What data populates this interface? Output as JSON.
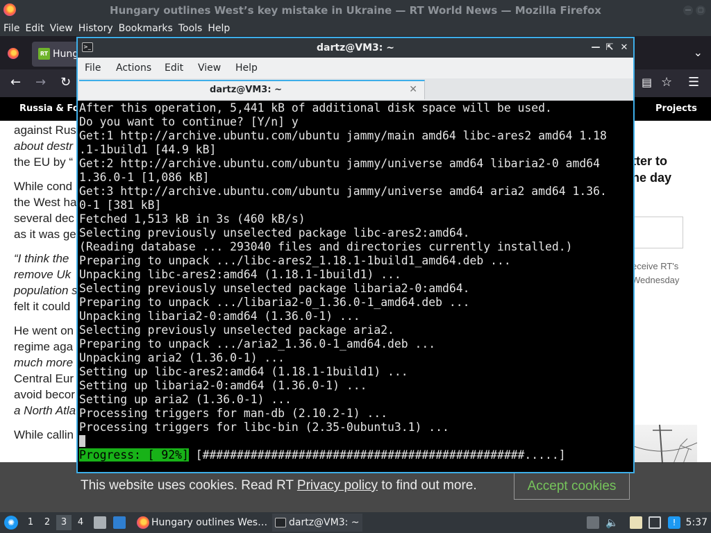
{
  "firefox": {
    "window_title": "Hungary outlines West’s key mistake in Ukraine — RT World News — Mozilla Firefox",
    "menu": [
      "File",
      "Edit",
      "View",
      "History",
      "Bookmarks",
      "Tools",
      "Help"
    ],
    "tab_title": "Hung",
    "tab_favicon": "RT",
    "rt_nav": {
      "left": "Russia & Fori",
      "right": "Projects"
    }
  },
  "article": {
    "paragraphs": [
      [
        {
          "t": "against Rus",
          "i": false
        },
        {
          "t": "about destr",
          "i": true
        },
        {
          "t": "the EU by “",
          "i": false
        }
      ],
      [
        {
          "t": "While cond",
          "i": false
        },
        {
          "t": "the West ha",
          "i": false
        },
        {
          "t": "several dec",
          "i": false
        },
        {
          "t": "as it was ge",
          "i": false
        }
      ],
      [
        {
          "t": "“I think the",
          "i": true
        },
        {
          "t": "remove Uk",
          "i": true
        },
        {
          "t": "population s",
          "i": true
        },
        {
          "t": "felt it could",
          "i": false
        }
      ],
      [
        {
          "t": "He went on",
          "i": false
        },
        {
          "t": "regime aga",
          "i": false
        },
        {
          "t": "much more",
          "i": true
        },
        {
          "t": "Central Eur",
          "i": false
        },
        {
          "t": "avoid becor",
          "i": false
        },
        {
          "t": "a North Atla",
          "i": true
        }
      ],
      [
        {
          "t": "While callin",
          "i": false
        }
      ]
    ]
  },
  "sidebar": {
    "promo": [
      "tter to",
      "ne day"
    ],
    "note": [
      "eceive RT's",
      " Wednesday"
    ]
  },
  "cookie": {
    "text_before": "This website uses cookies. Read RT ",
    "link": "Privacy policy",
    "text_after": " to find out more.",
    "button": "Accept cookies"
  },
  "terminal": {
    "window_title": "dartz@VM3: ~",
    "menu": [
      "File",
      "Actions",
      "Edit",
      "View",
      "Help"
    ],
    "tab_title": "dartz@VM3: ~",
    "lines": [
      "After this operation, 5,441 kB of additional disk space will be used.",
      "Do you want to continue? [Y/n] y",
      "Get:1 http://archive.ubuntu.com/ubuntu jammy/main amd64 libc-ares2 amd64 1.18",
      ".1-1build1 [44.9 kB]",
      "Get:2 http://archive.ubuntu.com/ubuntu jammy/universe amd64 libaria2-0 amd64",
      "1.36.0-1 [1,086 kB]",
      "Get:3 http://archive.ubuntu.com/ubuntu jammy/universe amd64 aria2 amd64 1.36.",
      "0-1 [381 kB]",
      "Fetched 1,513 kB in 3s (460 kB/s)",
      "Selecting previously unselected package libc-ares2:amd64.",
      "(Reading database ... 293040 files and directories currently installed.)",
      "Preparing to unpack .../libc-ares2_1.18.1-1build1_amd64.deb ...",
      "Unpacking libc-ares2:amd64 (1.18.1-1build1) ...",
      "Selecting previously unselected package libaria2-0:amd64.",
      "Preparing to unpack .../libaria2-0_1.36.0-1_amd64.deb ...",
      "Unpacking libaria2-0:amd64 (1.36.0-1) ...",
      "Selecting previously unselected package aria2.",
      "Preparing to unpack .../aria2_1.36.0-1_amd64.deb ...",
      "Unpacking aria2 (1.36.0-1) ...",
      "Setting up libc-ares2:amd64 (1.18.1-1build1) ...",
      "Setting up libaria2-0:amd64 (1.36.0-1) ...",
      "Setting up aria2 (1.36.0-1) ...",
      "Processing triggers for man-db (2.10.2-1) ...",
      "Processing triggers for libc-bin (2.35-0ubuntu3.1) ..."
    ],
    "progress_label": "Progress: [ 92%]",
    "progress_bar": " [###############################################.....]",
    "progress_value": 0.92
  },
  "taskbar": {
    "workspaces": [
      "1",
      "2",
      "3",
      "4"
    ],
    "active_workspace": "3",
    "tasks": [
      "Hungary outlines Wes…",
      "dartz@VM3: ~"
    ],
    "clock": "5:37"
  },
  "colors": {
    "accent": "#3daee9",
    "progress": "#18b218",
    "cookie_button": "#76c45b"
  }
}
